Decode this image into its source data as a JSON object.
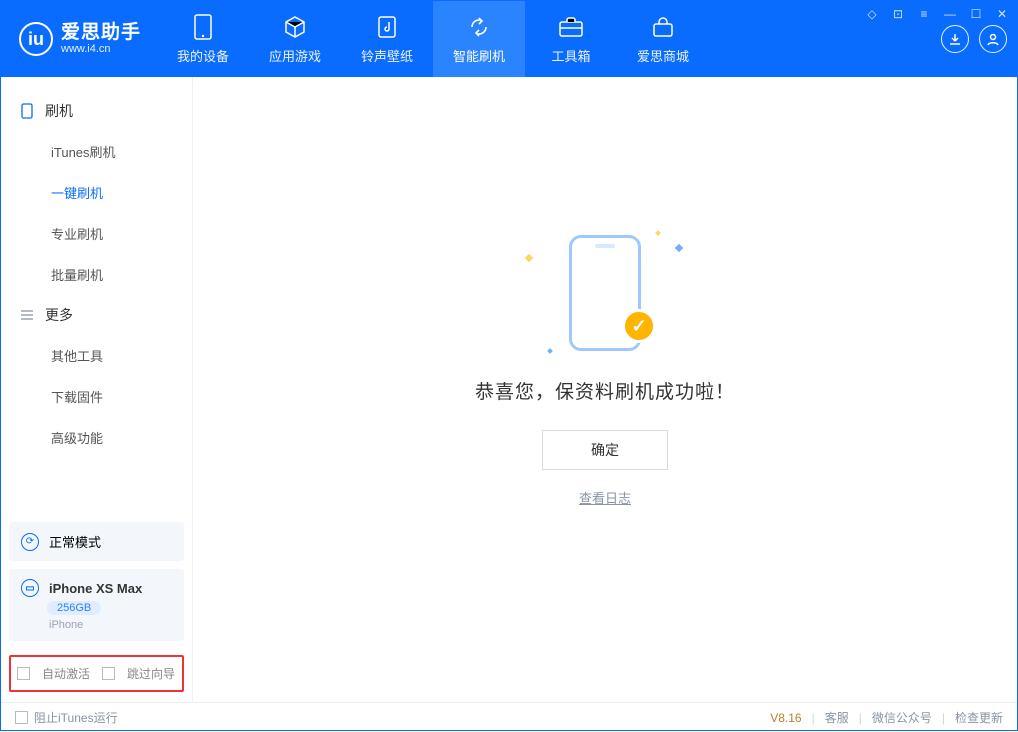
{
  "app": {
    "name": "爱思助手",
    "url": "www.i4.cn"
  },
  "nav": {
    "tabs": [
      {
        "label": "我的设备",
        "icon": "device-icon"
      },
      {
        "label": "应用游戏",
        "icon": "cube-icon"
      },
      {
        "label": "铃声壁纸",
        "icon": "music-icon"
      },
      {
        "label": "智能刷机",
        "icon": "refresh-icon"
      },
      {
        "label": "工具箱",
        "icon": "toolbox-icon"
      },
      {
        "label": "爱思商城",
        "icon": "shop-icon"
      }
    ],
    "active_index": 3
  },
  "sidebar": {
    "groups": [
      {
        "title": "刷机",
        "icon": "phone-icon",
        "items": [
          "iTunes刷机",
          "一键刷机",
          "专业刷机",
          "批量刷机"
        ],
        "active_index": 1
      },
      {
        "title": "更多",
        "icon": "list-icon",
        "items": [
          "其他工具",
          "下载固件",
          "高级功能"
        ],
        "active_index": -1
      }
    ],
    "mode_card": {
      "label": "正常模式"
    },
    "device_card": {
      "name": "iPhone XS Max",
      "storage": "256GB",
      "type": "iPhone"
    },
    "checks": {
      "auto_activate": "自动激活",
      "skip_guide": "跳过向导"
    }
  },
  "main": {
    "success_text": "恭喜您，保资料刷机成功啦！",
    "ok_label": "确定",
    "log_label": "查看日志"
  },
  "footer": {
    "block_itunes": "阻止iTunes运行",
    "version": "V8.16",
    "links": [
      "客服",
      "微信公众号",
      "检查更新"
    ]
  }
}
